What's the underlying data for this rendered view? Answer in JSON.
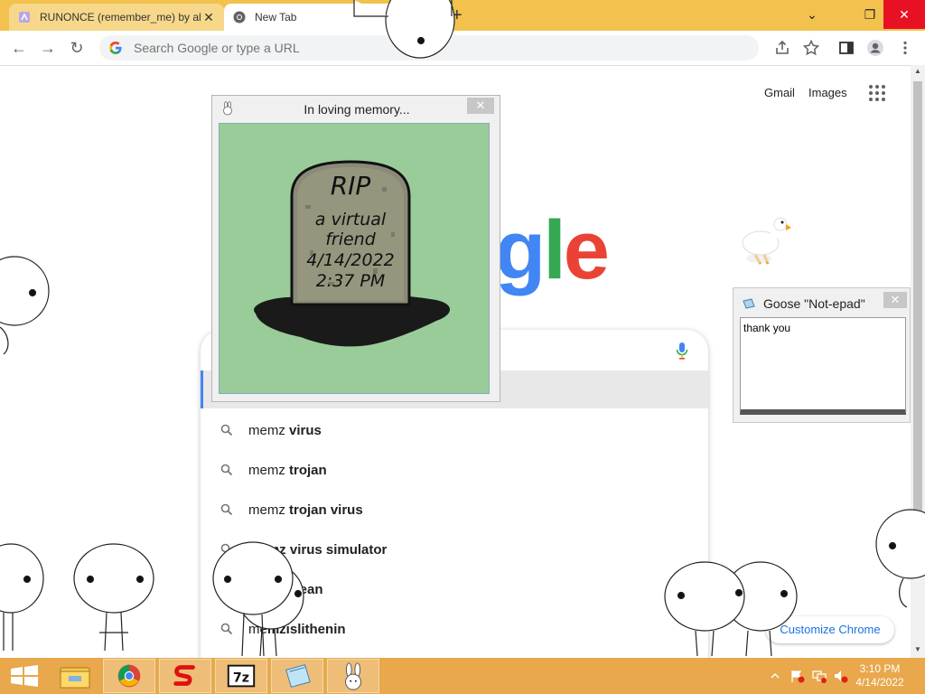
{
  "browser": {
    "tabs": [
      {
        "label": "RUNONCE (remember_me) by al",
        "active": false
      },
      {
        "label": "New Tab",
        "active": true
      }
    ],
    "new_tab_symbol": "+",
    "window_controls": {
      "tab_search": "⌄",
      "minimize": "—",
      "maximize": "❐",
      "close": "✕"
    },
    "omnibox_placeholder": "Search Google or type a URL"
  },
  "google": {
    "links": {
      "gmail": "Gmail",
      "images": "Images"
    },
    "logo_visible_letters": [
      {
        "text": "g",
        "color": "#4285f4"
      },
      {
        "text": "l",
        "color": "#34a853"
      },
      {
        "text": "e",
        "color": "#ea4335"
      }
    ],
    "suggestions": [
      {
        "prefix": "memz ",
        "bold": "virus"
      },
      {
        "prefix": "memz ",
        "bold": "trojan"
      },
      {
        "prefix": "memz ",
        "bold": "trojan virus"
      },
      {
        "prefix": "me",
        "bold": "mz virus simulator"
      },
      {
        "prefix": "memz c",
        "bold": "lean"
      },
      {
        "prefix": "me",
        "bold": "mzislithenin"
      }
    ],
    "customize_label": "Customize Chrome"
  },
  "memorial_window": {
    "title": "In loving memory...",
    "close": "✕",
    "tombstone": {
      "rip": "RIP",
      "lines": [
        "a virtual",
        "friend",
        "4/14/2022",
        "2:37 PM"
      ]
    },
    "background_color": "#99cc99"
  },
  "notepad_window": {
    "title": "Goose \"Not-epad\"",
    "close": "✕",
    "text": "thank you"
  },
  "taskbar": {
    "apps": [
      "windows-start",
      "file-explorer",
      "chrome",
      "red-s-app",
      "7zip",
      "notepad-app",
      "bunny-app"
    ],
    "time": "3:10 PM",
    "date": "4/14/2022",
    "accent": "#e8a84b"
  }
}
